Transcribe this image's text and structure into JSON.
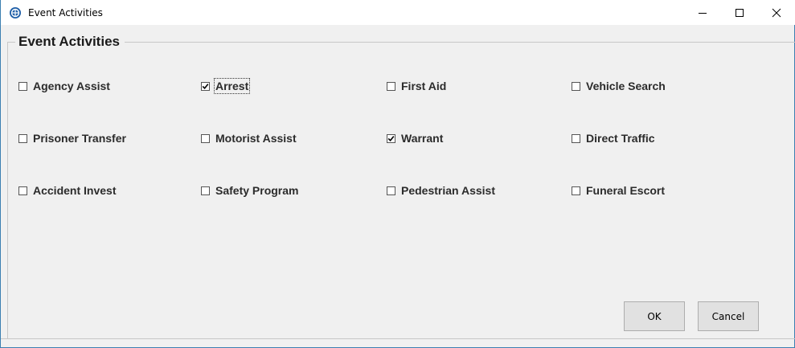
{
  "window": {
    "title": "Event Activities",
    "icon": "globe-icon",
    "controls": [
      "minimize-icon",
      "maximize-icon",
      "close-icon"
    ]
  },
  "group": {
    "title": "Event Activities"
  },
  "activities": [
    {
      "label": "Agency Assist",
      "checked": false
    },
    {
      "label": "Arrest",
      "checked": true
    },
    {
      "label": "First Aid",
      "checked": false
    },
    {
      "label": "Vehicle Search",
      "checked": false
    },
    {
      "label": "Prisoner Transfer",
      "checked": false
    },
    {
      "label": "Motorist Assist",
      "checked": false
    },
    {
      "label": "Warrant",
      "checked": true
    },
    {
      "label": "Direct Traffic",
      "checked": false
    },
    {
      "label": "Accident Invest",
      "checked": false
    },
    {
      "label": "Safety Program",
      "checked": false
    },
    {
      "label": "Pedestrian Assist",
      "checked": false
    },
    {
      "label": "Funeral Escort",
      "checked": false
    }
  ],
  "buttons": {
    "ok": "OK",
    "cancel": "Cancel"
  },
  "colors": {
    "window_border": "#3c7fb1",
    "icon_accent": "#1f5fa8"
  }
}
